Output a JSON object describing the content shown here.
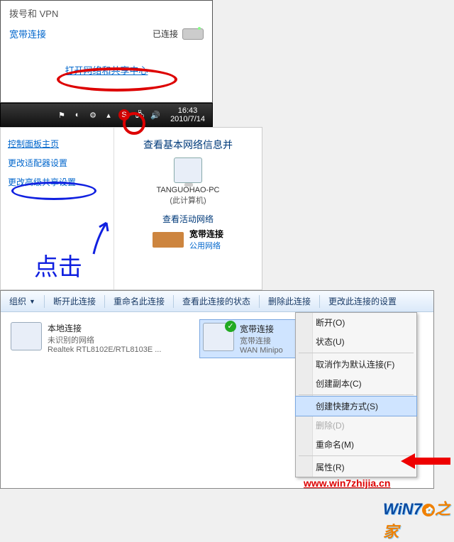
{
  "tray_popup": {
    "section_title": "拨号和 VPN",
    "connection_name": "宽带连接",
    "status_label": "已连接",
    "open_center_link": "打开网络和共享中心"
  },
  "taskbar": {
    "time": "16:43",
    "date": "2010/7/14"
  },
  "control_panel": {
    "home_link": "控制面板主页",
    "adapter_link": "更改适配器设置",
    "sharing_link": "更改高级共享设置",
    "heading": "查看基本网络信息并",
    "pc_name": "TANGUOHAO-PC",
    "pc_sub": "(此计算机)",
    "active_net_heading": "查看活动网络",
    "broadband_name": "宽带连接",
    "public_network": "公用网络",
    "ink_text": "点击"
  },
  "connections": {
    "toolbar": {
      "organize": "组织",
      "disconnect": "断开此连接",
      "rename": "重命名此连接",
      "status": "查看此连接的状态",
      "delete": "删除此连接",
      "settings": "更改此连接的设置"
    },
    "items": [
      {
        "title": "本地连接",
        "sub1": "未识别的网络",
        "sub2": "Realtek RTL8102E/RTL8103E ..."
      },
      {
        "title": "宽带连接",
        "sub1": "宽带连接",
        "sub2": "WAN Minipo"
      }
    ],
    "context_menu": {
      "disconnect": "断开(O)",
      "status": "状态(U)",
      "cancel_default": "取消作为默认连接(F)",
      "copy": "创建副本(C)",
      "shortcut": "创建快捷方式(S)",
      "delete": "删除(D)",
      "rename": "重命名(M)",
      "properties": "属性(R)"
    }
  },
  "watermark": {
    "url": "www.win7zhijia.cn",
    "brand": "WiN7",
    "brand_suffix": "之家"
  }
}
